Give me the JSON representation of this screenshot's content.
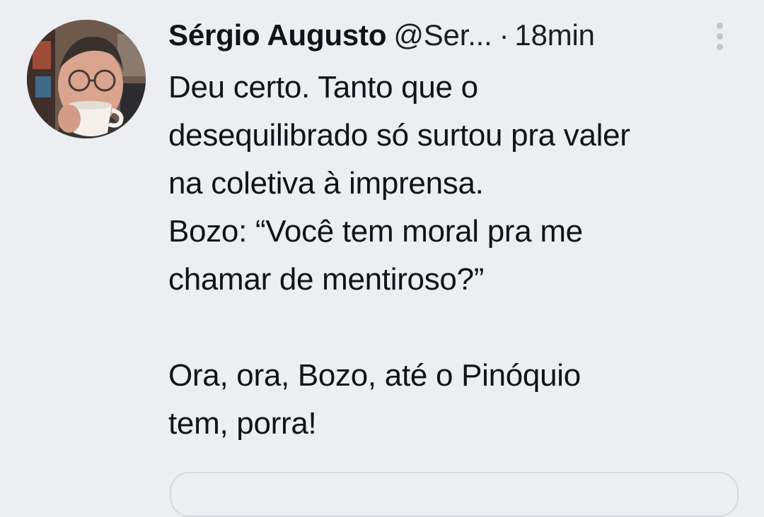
{
  "tweet": {
    "author": {
      "name": "Sérgio Augusto",
      "handle": "@Ser...",
      "separator": "·",
      "time": "18min",
      "avatar_icon": "profile-photo"
    },
    "more_icon": "vertical-ellipsis-icon",
    "lines": [
      "Deu certo. Tanto que o",
      "desequilibrado só surtou pra valer",
      "na coletiva à imprensa.",
      "Bozo: “Você tem moral pra me",
      "chamar de mentiroso?”",
      "",
      "Ora, ora, Bozo, até o Pinóquio",
      "tem, porra!"
    ]
  },
  "colors": {
    "background": "#eceef1",
    "text": "#0f1419",
    "muted_icon": "#c3c7cc",
    "card_border": "#d6d9dd"
  }
}
